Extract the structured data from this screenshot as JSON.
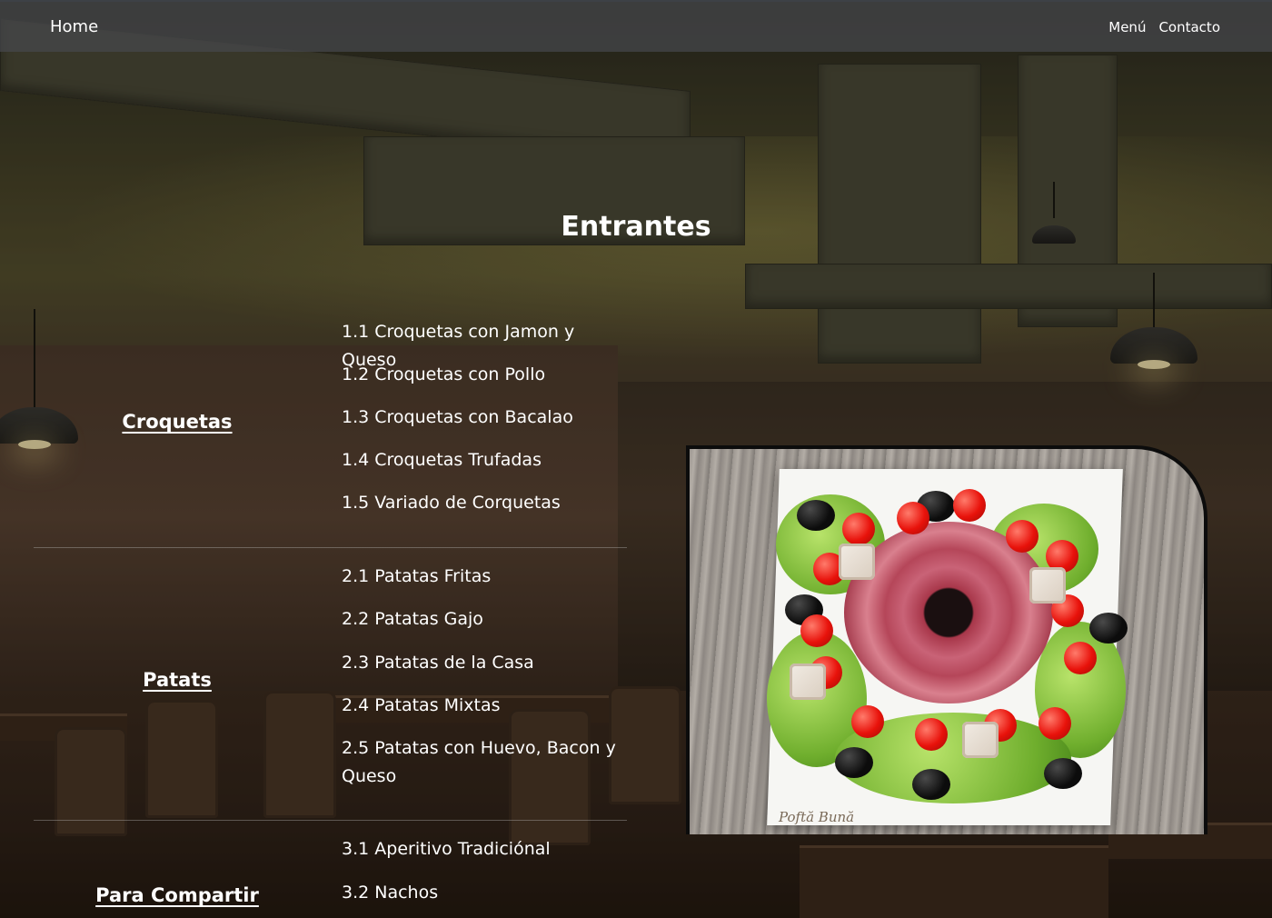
{
  "navbar": {
    "brand": "Home",
    "links": [
      "Menú",
      "Contacto"
    ]
  },
  "page_title": "Entrantes",
  "categories": [
    {
      "name": "Croquetas",
      "items": [
        "1.1 Croquetas con Jamon y Queso",
        "1.2 Croquetas con Pollo",
        "1.3 Croquetas con Bacalao",
        "1.4 Croquetas Trufadas",
        "1.5 Variado de Corquetas"
      ]
    },
    {
      "name": "Patats",
      "items": [
        "2.1 Patatas Fritas",
        "2.2 Patatas Gajo",
        "2.3 Patatas de la Casa",
        "2.4 Patatas Mixtas",
        "2.5 Patatas con Huevo, Bacon y Queso"
      ]
    },
    {
      "name": "Para Compartir",
      "items": [
        "3.1 Aperitivo Tradiciónal",
        "3.2 Nachos"
      ]
    }
  ],
  "food_image": {
    "watermark": "Poftă Bună"
  },
  "colors": {
    "navbar_bg": "#46484c",
    "text": "#ffffff"
  }
}
